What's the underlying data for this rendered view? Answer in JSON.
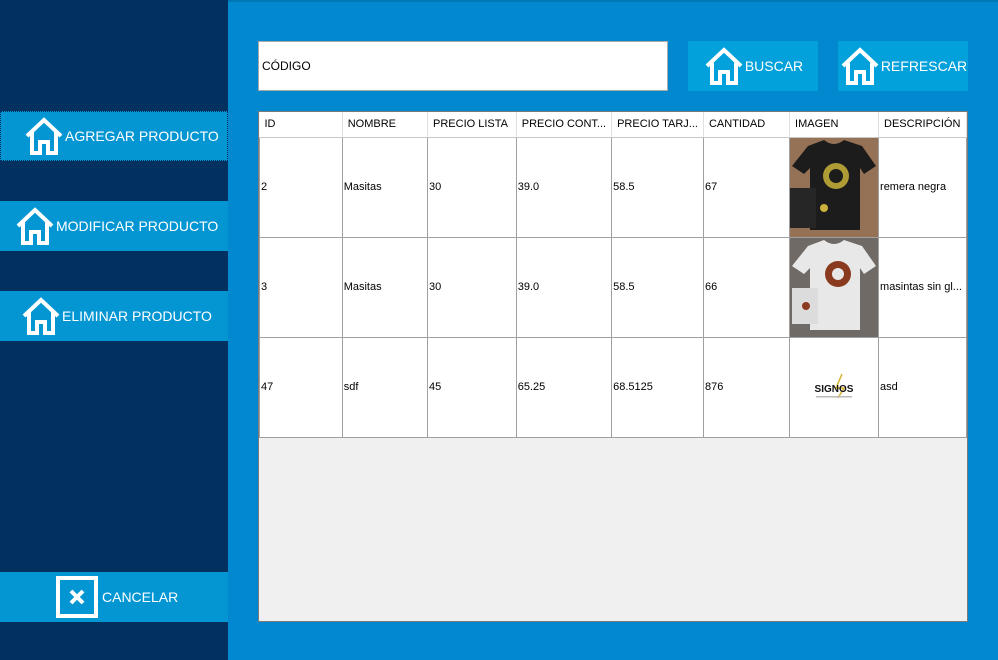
{
  "sidebar": {
    "add_label": "AGREGAR PRODUCTO",
    "modify_label": "MODIFICAR PRODUCTO",
    "delete_label": "ELIMINAR PRODUCTO",
    "cancel_label": "CANCELAR"
  },
  "search": {
    "value": "CÓDIGO"
  },
  "toolbar": {
    "search_label": "BUSCAR",
    "refresh_label": "REFRESCAR"
  },
  "table": {
    "columns": [
      "ID",
      "NOMBRE",
      "PRECIO LISTA",
      "PRECIO CONT...",
      "PRECIO TARJ...",
      "CANTIDAD",
      "IMAGEN",
      "DESCRIPCIÓN"
    ],
    "rows": [
      {
        "id": "2",
        "nombre": "Masitas",
        "precio_lista": "30",
        "precio_contado": "39.0",
        "precio_tarjeta": "58.5",
        "cantidad": "67",
        "imagen": "black-tshirt-image",
        "descripcion": "remera negra"
      },
      {
        "id": "3",
        "nombre": "Masitas",
        "precio_lista": "30",
        "precio_contado": "39.0",
        "precio_tarjeta": "58.5",
        "cantidad": "66",
        "imagen": "white-tshirt-image",
        "descripcion": "masintas sin gl..."
      },
      {
        "id": "47",
        "nombre": "sdf",
        "precio_lista": "45",
        "precio_contado": "65.25",
        "precio_tarjeta": "68.5125",
        "cantidad": "876",
        "imagen": "signos-logo-image",
        "descripcion": "asd",
        "logo_text": "SIGNOS"
      }
    ]
  },
  "colors": {
    "sidebar_bg": "#02305f",
    "main_bg": "#0288cf",
    "button_bg": "#0396d3",
    "text_white": "#ffffff"
  },
  "icons": {
    "home": "home-icon",
    "close": "close-icon"
  }
}
